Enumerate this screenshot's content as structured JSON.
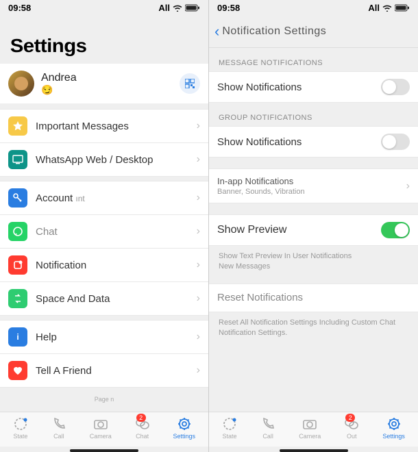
{
  "status": {
    "time": "09:58",
    "carrier": "All"
  },
  "left": {
    "title": "Settings",
    "profile": {
      "name": "Andrea",
      "emoji": "😏"
    },
    "items": {
      "important": "Important Messages",
      "web": "WhatsApp Web / Desktop",
      "account": "Account",
      "account_suffix": "ınt",
      "chat": "Chat",
      "notification": "Notification",
      "storage": "Space And Data",
      "help": "Help",
      "tell": "Tell A Friend"
    },
    "page_note": "Page n"
  },
  "right": {
    "nav_title": "Notification Settings",
    "sections": {
      "msg_header": "MESSAGE NOTIFICATIONS",
      "grp_header": "GROUP NOTIFICATIONS",
      "show_notifications": "Show Notifications",
      "inapp": "In-app Notifications",
      "inapp_sub": "Banner, Sounds, Vibration",
      "preview": "Show Preview",
      "preview_sub1": "Show Text Preview In User Notifications",
      "preview_sub2": "New Messages",
      "reset": "Reset Notifications",
      "reset_sub": "Reset All Notification Settings Including Custom Chat Notification Settings."
    }
  },
  "tabs": {
    "state": "State",
    "call": "Call",
    "camera": "Camera",
    "chat": "Chat",
    "out": "Out",
    "settings": "Settings",
    "badge": "2"
  }
}
